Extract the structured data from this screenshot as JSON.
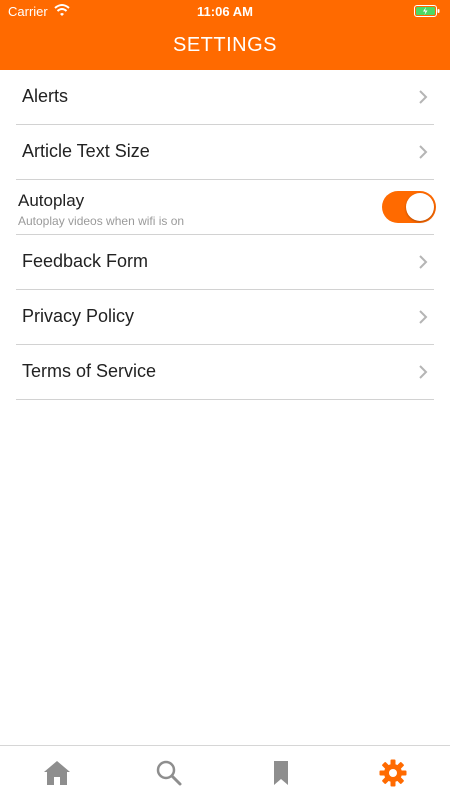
{
  "status_bar": {
    "carrier": "Carrier",
    "time": "11:06 AM",
    "wifi_icon": "wifi-icon",
    "battery_icon": "battery-charging-icon"
  },
  "header": {
    "title": "SETTINGS",
    "background_color": "#ff6a00"
  },
  "settings": {
    "items": [
      {
        "label": "Alerts",
        "type": "link"
      },
      {
        "label": "Article Text Size",
        "type": "link"
      },
      {
        "label": "Autoplay",
        "subtitle": "Autoplay videos when wifi is on",
        "type": "toggle",
        "enabled": true
      },
      {
        "label": "Feedback Form",
        "type": "link"
      },
      {
        "label": "Privacy Policy",
        "type": "link"
      },
      {
        "label": "Terms of Service",
        "type": "link"
      }
    ]
  },
  "tabbar": {
    "tabs": [
      {
        "icon": "home-icon",
        "active": false
      },
      {
        "icon": "search-icon",
        "active": false
      },
      {
        "icon": "bookmark-icon",
        "active": false
      },
      {
        "icon": "gear-icon",
        "active": true
      }
    ],
    "active_color": "#ff6a00",
    "inactive_color": "#8e8e8e"
  }
}
